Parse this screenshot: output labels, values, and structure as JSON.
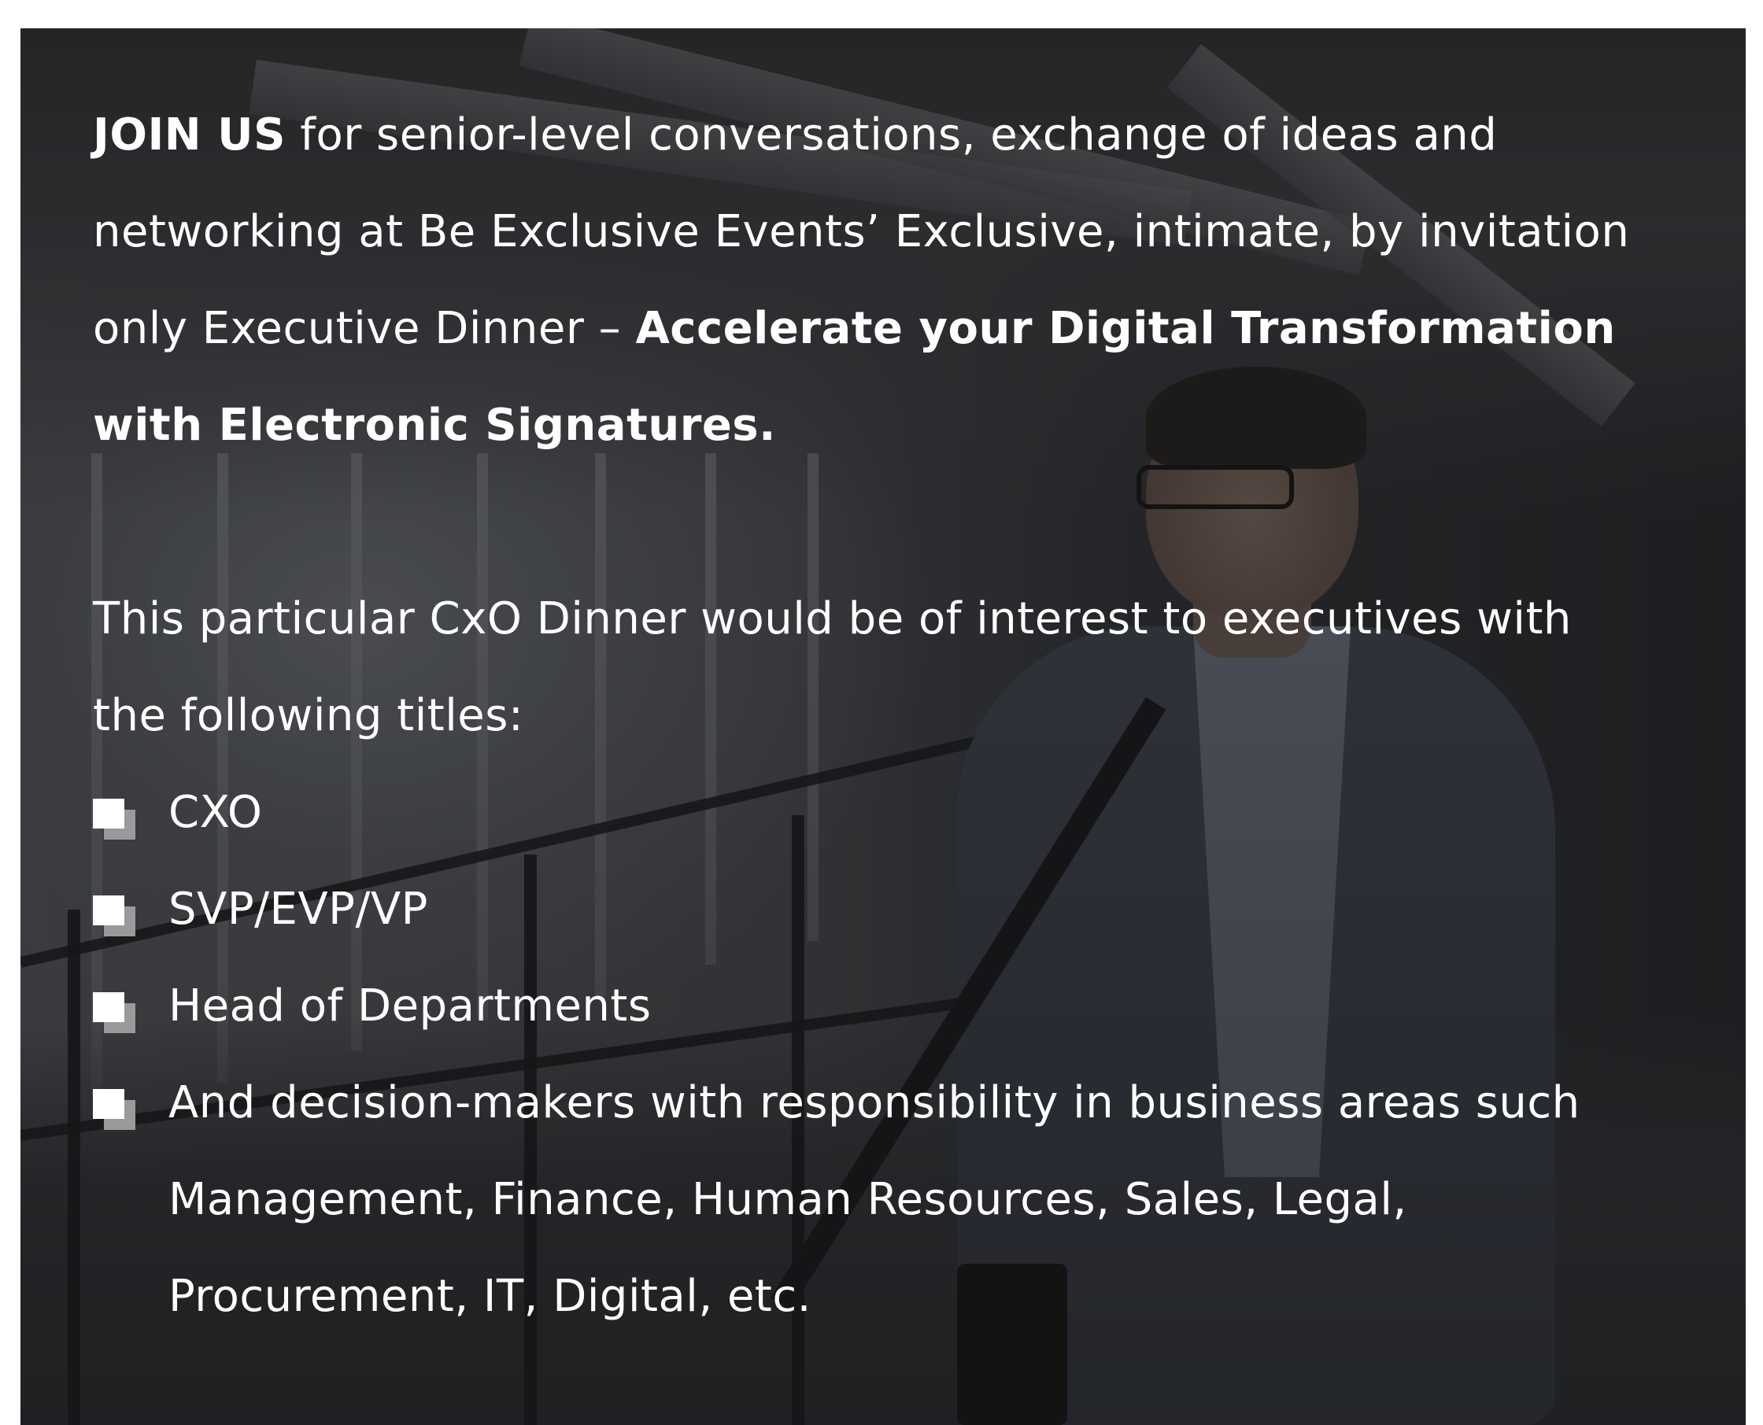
{
  "intro": {
    "lead_bold": "JOIN US",
    "lead_text": " for senior-level conversations, exchange of ideas and networking at Be Exclusive Events’ Exclusive, intimate, by invitation only Executive Dinner –  ",
    "event_title": "Accelerate your Digital Transformation with Electronic Signatures."
  },
  "audience": {
    "text": "This particular CxO Dinner would be of interest to executives with the following titles:",
    "titles": [
      "CXO",
      "SVP/EVP/VP",
      "Head of Departments",
      "And decision-makers with responsibility in business areas such Management, Finance, Human Resources, Sales, Legal, Procurement, IT, Digital, etc."
    ]
  },
  "colors": {
    "text": "#ffffff",
    "overlay": "#121214",
    "bullet_front": "#ffffff",
    "bullet_back": "#9a9a9a"
  },
  "icons": {
    "bullet": "checkbox-square-icon"
  }
}
